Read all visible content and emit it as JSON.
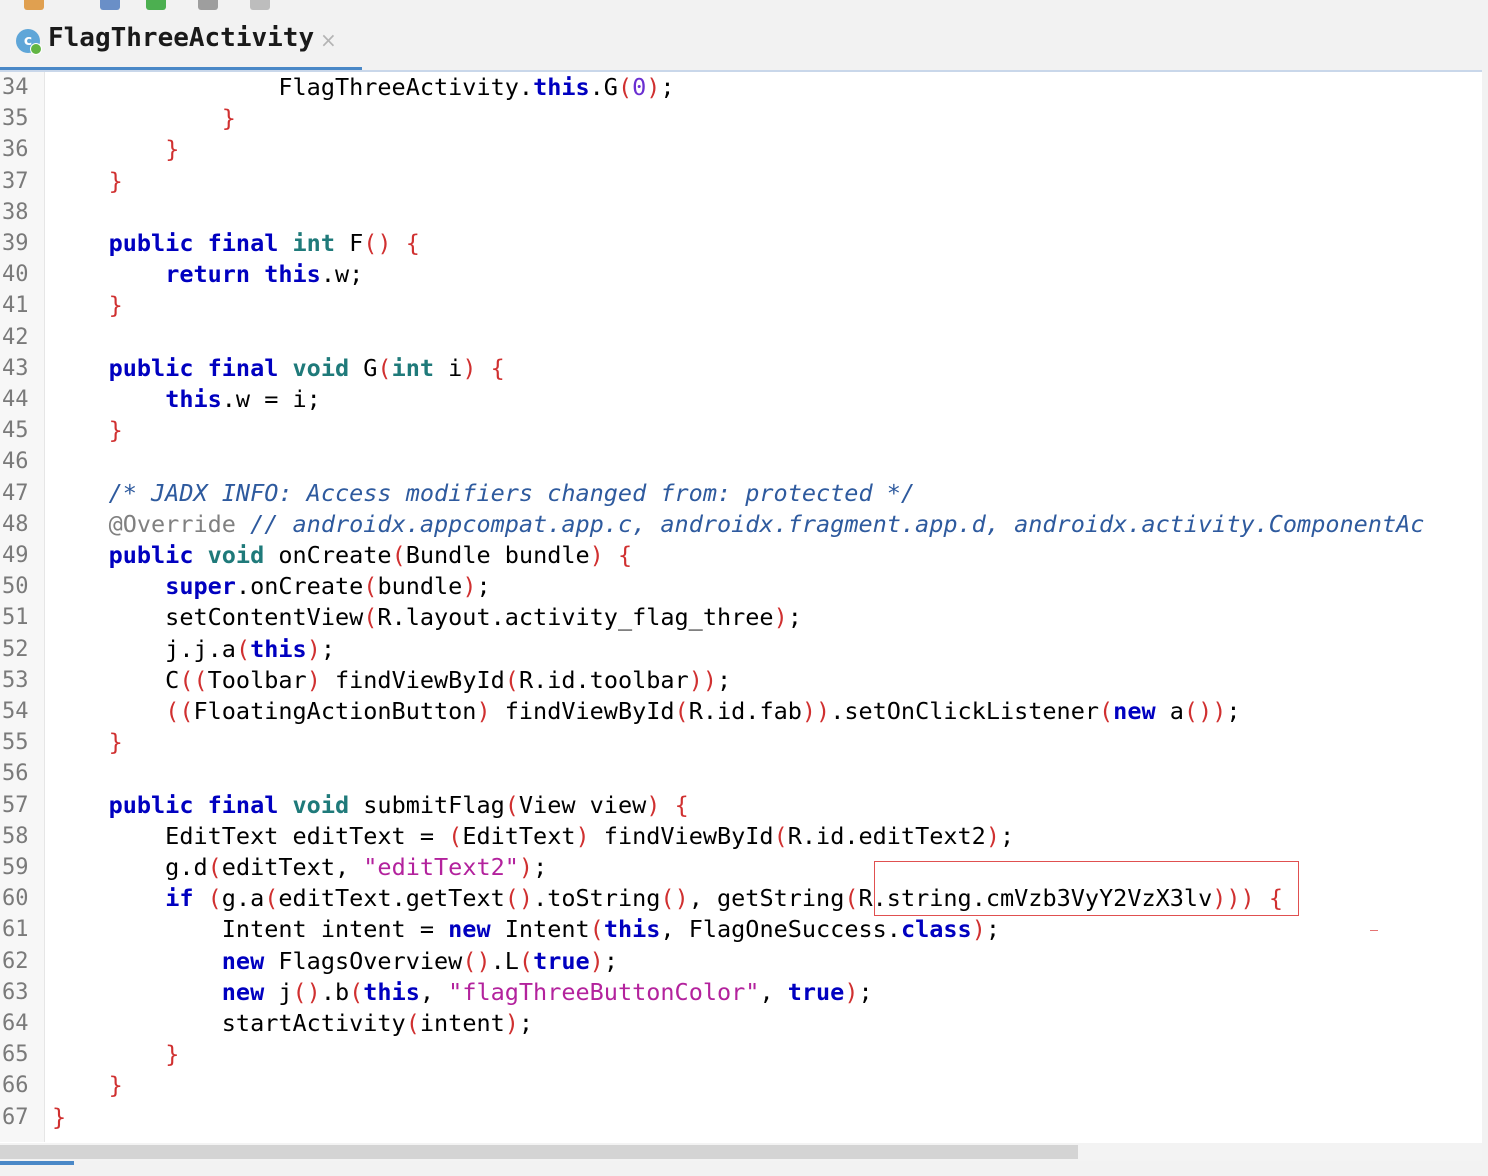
{
  "tab": {
    "title": "FlagThreeActivity",
    "close": "×",
    "icon_letter": "c"
  },
  "lines": [
    {
      "n": "34",
      "code": "<span data-name=\"identifier\">FlagThreeActivity</span>.<span class=\"kw\">this</span>.G<span class=\"br\">(</span><span class=\"num\">0</span><span class=\"br\">)</span>;",
      "indent": "                "
    },
    {
      "n": "35",
      "code": "<span class=\"br\">}</span>",
      "indent": "            "
    },
    {
      "n": "36",
      "code": "<span class=\"br\">}</span>",
      "indent": "        "
    },
    {
      "n": "37",
      "code": "<span class=\"br\">}</span>",
      "indent": "    "
    },
    {
      "n": "38",
      "code": "",
      "indent": ""
    },
    {
      "n": "39",
      "code": "<span class=\"kw\">public final</span> <span class=\"ty\">int</span> F<span class=\"br\">()</span> <span class=\"br\">{</span>",
      "indent": "    "
    },
    {
      "n": "40",
      "code": "<span class=\"kw\">return this</span>.w;",
      "indent": "        "
    },
    {
      "n": "41",
      "code": "<span class=\"br\">}</span>",
      "indent": "    "
    },
    {
      "n": "42",
      "code": "",
      "indent": ""
    },
    {
      "n": "43",
      "code": "<span class=\"kw\">public final</span> <span class=\"ty\">void</span> G<span class=\"br\">(</span><span class=\"ty\">int</span> i<span class=\"br\">)</span> <span class=\"br\">{</span>",
      "indent": "    "
    },
    {
      "n": "44",
      "code": "<span class=\"kw\">this</span>.w = i;",
      "indent": "        "
    },
    {
      "n": "45",
      "code": "<span class=\"br\">}</span>",
      "indent": "    "
    },
    {
      "n": "46",
      "code": "",
      "indent": ""
    },
    {
      "n": "47",
      "code": "<span class=\"cm\">/* JADX INFO: Access modifiers changed from: protected */</span>",
      "indent": "    "
    },
    {
      "n": "48",
      "code": "<span class=\"ann\">@Override</span> <span class=\"cm\">// androidx.appcompat.app.c, androidx.fragment.app.d, androidx.activity.ComponentAc</span>",
      "indent": "    "
    },
    {
      "n": "49",
      "code": "<span class=\"kw\">public</span> <span class=\"ty\">void</span> onCreate<span class=\"br\">(</span>Bundle bundle<span class=\"br\">)</span> <span class=\"br\">{</span>",
      "indent": "    "
    },
    {
      "n": "50",
      "code": "<span class=\"kw\">super</span>.onCreate<span class=\"br\">(</span>bundle<span class=\"br\">)</span>;",
      "indent": "        "
    },
    {
      "n": "51",
      "code": "setContentView<span class=\"br\">(</span>R.layout.activity_flag_three<span class=\"br\">)</span>;",
      "indent": "        "
    },
    {
      "n": "52",
      "code": "j.j.a<span class=\"br\">(</span><span class=\"kw\">this</span><span class=\"br\">)</span>;",
      "indent": "        "
    },
    {
      "n": "53",
      "code": "C<span class=\"br\">((</span>Toolbar<span class=\"br\">)</span> findViewById<span class=\"br\">(</span>R.id.toolbar<span class=\"br\">))</span>;",
      "indent": "        "
    },
    {
      "n": "54",
      "code": "<span class=\"br\">((</span>FloatingActionButton<span class=\"br\">)</span> findViewById<span class=\"br\">(</span>R.id.fab<span class=\"br\">))</span>.setOnClickListener<span class=\"br\">(</span><span class=\"kw\">new</span> a<span class=\"br\">())</span>;",
      "indent": "        "
    },
    {
      "n": "55",
      "code": "<span class=\"br\">}</span>",
      "indent": "    "
    },
    {
      "n": "56",
      "code": "",
      "indent": ""
    },
    {
      "n": "57",
      "code": "<span class=\"kw\">public final</span> <span class=\"ty\">void</span> submitFlag<span class=\"br\">(</span>View view<span class=\"br\">)</span> <span class=\"br\">{</span>",
      "indent": "    "
    },
    {
      "n": "58",
      "code": "EditText editText = <span class=\"br\">(</span>EditText<span class=\"br\">)</span> findViewById<span class=\"br\">(</span>R.id.editText2<span class=\"br\">)</span>;",
      "indent": "        "
    },
    {
      "n": "59",
      "code": "g.d<span class=\"br\">(</span>editText, <span class=\"str\">\"editText2\"</span><span class=\"br\">)</span>;",
      "indent": "        "
    },
    {
      "n": "60",
      "code": "<span class=\"kw\">if</span> <span class=\"br\">(</span>g.a<span class=\"br\">(</span>editText.getText<span class=\"br\">()</span>.toString<span class=\"br\">()</span>, getString<span class=\"br\">(</span>R.string.cmVzb3VyY2VzX3lv<span class=\"br\">)))</span> <span class=\"br\">{</span>",
      "indent": "        "
    },
    {
      "n": "61",
      "code": "Intent intent = <span class=\"kw\">new</span> Intent<span class=\"br\">(</span><span class=\"kw\">this</span>, FlagOneSuccess.<span class=\"kw\">class</span><span class=\"br\">)</span>;",
      "indent": "            "
    },
    {
      "n": "62",
      "code": "<span class=\"kw\">new</span> FlagsOverview<span class=\"br\">()</span>.L<span class=\"br\">(</span><span class=\"kw\">true</span><span class=\"br\">)</span>;",
      "indent": "            "
    },
    {
      "n": "63",
      "code": "<span class=\"kw\">new</span> j<span class=\"br\">()</span>.b<span class=\"br\">(</span><span class=\"kw\">this</span>, <span class=\"str\">\"flagThreeButtonColor\"</span>, <span class=\"kw\">true</span><span class=\"br\">)</span>;",
      "indent": "            "
    },
    {
      "n": "64",
      "code": "startActivity<span class=\"br\">(</span>intent<span class=\"br\">)</span>;",
      "indent": "            "
    },
    {
      "n": "65",
      "code": "<span class=\"br\">}</span>",
      "indent": "        "
    },
    {
      "n": "66",
      "code": "<span class=\"br\">}</span>",
      "indent": "    "
    },
    {
      "n": "67",
      "code": "<span class=\"br\">}</span>",
      "indent": ""
    }
  ]
}
